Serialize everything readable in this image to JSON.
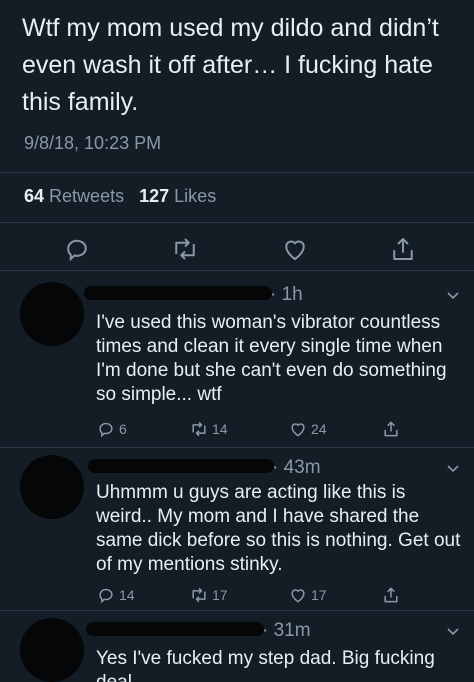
{
  "tweet": {
    "text": "Wtf my mom used my dildo and didn’t even wash it off after… I fucking hate this family.",
    "timestamp": "9/8/18, 10:23 PM",
    "retweets_count": "64",
    "retweets_label": "Retweets",
    "likes_count": "127",
    "likes_label": "Likes"
  },
  "replies": [
    {
      "time": "· 1h",
      "text": "I've used this woman's vibrator countless times and clean it every single time when I'm done but she can't even do something so simple... wtf",
      "reply_count": "6",
      "retweet_count": "14",
      "like_count": "24"
    },
    {
      "time": "· 43m",
      "text": "Uhmmm u guys are acting like this is weird.. My mom and I have shared the same dick before so this is nothing. Get out of my mentions stinky.",
      "reply_count": "14",
      "retweet_count": "17",
      "like_count": "17"
    },
    {
      "time": "· 31m",
      "text": "Yes I've fucked my step dad. Big fucking deal"
    }
  ],
  "colors": {
    "background": "#141d26",
    "text": "#e9eef2",
    "secondary": "#8899a6",
    "divider": "#2a3845"
  },
  "icons": [
    "reply-icon",
    "retweet-icon",
    "like-icon",
    "share-icon",
    "chevron-down-icon"
  ]
}
